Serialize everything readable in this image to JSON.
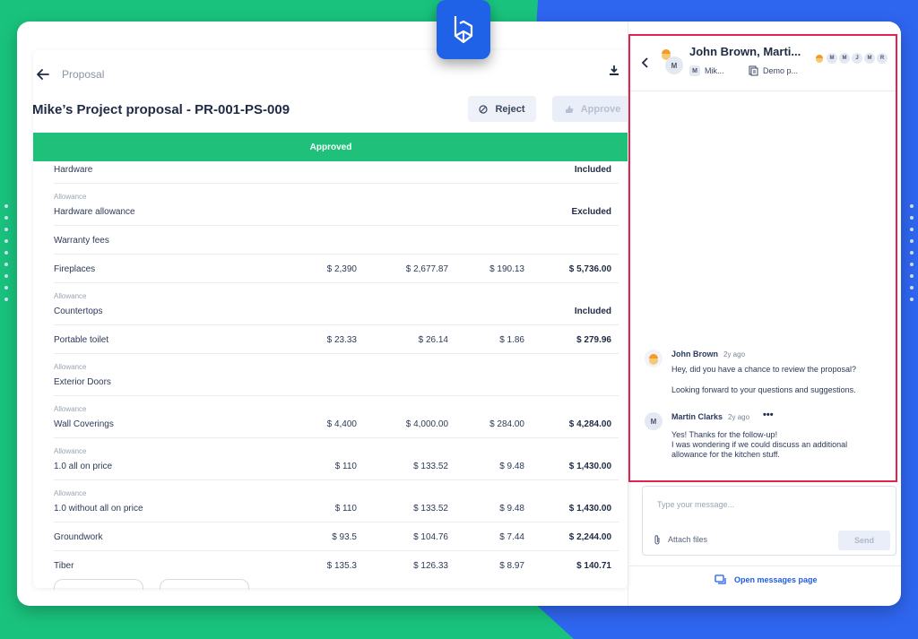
{
  "colors": {
    "accent": "#1f5ce6",
    "success": "#1fc07a",
    "highlight": "#e0244d",
    "brand_green": "#19c37d",
    "brand_blue": "#2f66f0"
  },
  "header": {
    "breadcrumb": "Proposal",
    "title": "Mike’s Project proposal - PR-001-PS-009",
    "reject_label": "Reject",
    "approve_label": "Approve"
  },
  "status_banner": "Approved",
  "table": {
    "rows": [
      {
        "sub": "",
        "name": "Hardware",
        "c1": "",
        "c2": "",
        "c3": "",
        "total": "Included"
      },
      {
        "sub": "Allowance",
        "name": "Hardware allowance",
        "c1": "",
        "c2": "",
        "c3": "",
        "total": "Excluded"
      },
      {
        "sub": "",
        "name": "Warranty fees",
        "c1": "",
        "c2": "",
        "c3": "",
        "total": ""
      },
      {
        "sub": "",
        "name": "Fireplaces",
        "c1": "$ 2,390",
        "c2": "$ 2,677.87",
        "c3": "$ 190.13",
        "total": "$ 5,736.00"
      },
      {
        "sub": "Allowance",
        "name": "Countertops",
        "c1": "",
        "c2": "",
        "c3": "",
        "total": "Included"
      },
      {
        "sub": "",
        "name": "Portable toilet",
        "c1": "$ 23.33",
        "c2": "$ 26.14",
        "c3": "$ 1.86",
        "total": "$ 279.96"
      },
      {
        "sub": "Allowance",
        "name": "Exterior Doors",
        "c1": "",
        "c2": "",
        "c3": "",
        "total": ""
      },
      {
        "sub": "Allowance",
        "name": "Wall Coverings",
        "c1": "$ 4,400",
        "c2": "$ 4,000.00",
        "c3": "$ 284.00",
        "total": "$ 4,284.00"
      },
      {
        "sub": "Allowance",
        "name": "1.0 all on price",
        "c1": "$ 110",
        "c2": "$ 133.52",
        "c3": "$ 9.48",
        "total": "$ 1,430.00"
      },
      {
        "sub": "Allowance",
        "name": "1.0 without all on price",
        "c1": "$ 110",
        "c2": "$ 133.52",
        "c3": "$ 9.48",
        "total": "$ 1,430.00"
      },
      {
        "sub": "",
        "name": "Groundwork",
        "c1": "$ 93.5",
        "c2": "$ 104.76",
        "c3": "$ 7.44",
        "total": "$ 2,244.00"
      },
      {
        "sub": "",
        "name": "Tiber",
        "c1": "$ 135.3",
        "c2": "$ 126.33",
        "c3": "$ 8.97",
        "total": "$ 140.71"
      }
    ]
  },
  "chat": {
    "title": "John Brown, Marti...",
    "meta_user_initial": "M",
    "meta_user": "Mik...",
    "meta_project": "Demo p...",
    "header_avatar_initial": "M",
    "participants": [
      "M",
      "M",
      "J",
      "M",
      "R"
    ],
    "messages": [
      {
        "author": "John Brown",
        "time": "2y ago",
        "avatar": "",
        "lines": [
          "Hey, did you have a chance to review the proposal?",
          "Looking forward to your questions and suggestions."
        ]
      },
      {
        "author": "Martin Clarks",
        "time": "2y ago",
        "avatar": "M",
        "lines": [
          "Yes! Thanks for the follow-up!",
          "I was wondering if we could discuss an additional",
          "allowance for the kitchen stuff."
        ]
      }
    ],
    "more_label": "•••",
    "compose_placeholder": "Type your message...",
    "attach_label": "Attach files",
    "send_label": "Send",
    "open_messages_label": "Open messages page"
  }
}
